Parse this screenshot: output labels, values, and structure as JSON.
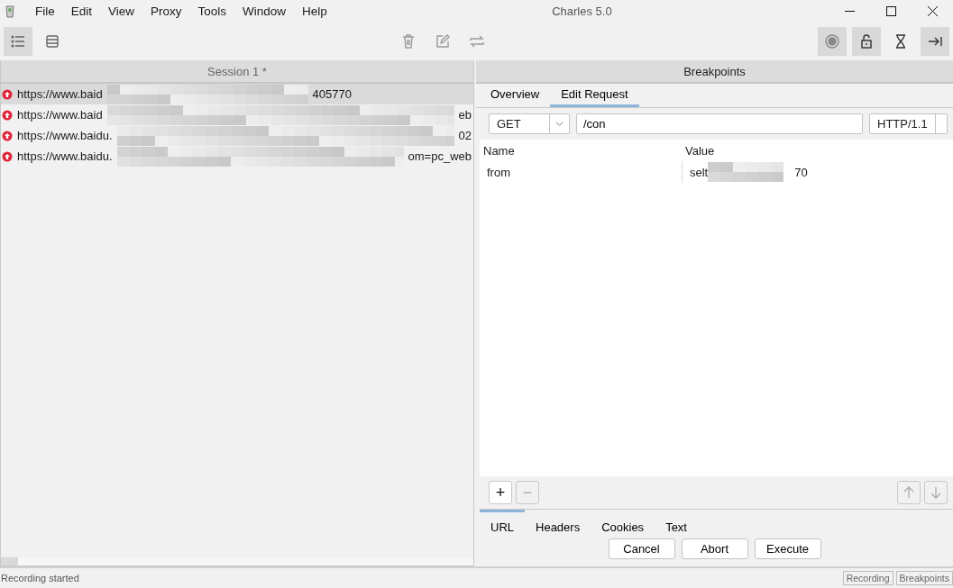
{
  "window": {
    "title": "Charles 5.0"
  },
  "menu": [
    "File",
    "Edit",
    "View",
    "Proxy",
    "Tools",
    "Window",
    "Help"
  ],
  "toolbar": {
    "left": [
      {
        "kind": "list",
        "active": true
      },
      {
        "kind": "rows",
        "active": false
      }
    ],
    "middle": [
      {
        "kind": "trash",
        "active": false
      },
      {
        "kind": "edit",
        "active": false
      },
      {
        "kind": "repeat",
        "active": false
      }
    ],
    "right": [
      {
        "kind": "record",
        "active": true
      },
      {
        "kind": "lock",
        "active": true
      },
      {
        "kind": "hourglass",
        "active": false
      },
      {
        "kind": "step",
        "active": true
      }
    ]
  },
  "session": {
    "title": "Session 1 *",
    "rows": [
      {
        "start": "https://www.baid",
        "end": "405770",
        "selected": true
      },
      {
        "start": "https://www.baid",
        "end": "eb",
        "selected": false
      },
      {
        "start": "https://www.baidu.",
        "end": "02",
        "selected": false
      },
      {
        "start": "https://www.baidu.",
        "end": "om=pc_web",
        "selected": false
      }
    ]
  },
  "breakpoints": {
    "title": "Breakpoints",
    "tabs": [
      {
        "label": "Overview",
        "selected": false
      },
      {
        "label": "Edit Request",
        "selected": true
      }
    ],
    "method": "GET",
    "path": "/con",
    "protocol": "HTTP/1.1",
    "columns": [
      "Name",
      "Value"
    ],
    "params": [
      {
        "name": "from",
        "value_start": "selt",
        "value_end": "70"
      }
    ],
    "row_buttons": [
      {
        "label": "+",
        "disabled": false
      },
      {
        "label": "−",
        "disabled": true
      }
    ],
    "move_buttons": [
      {
        "kind": "up",
        "disabled": true
      },
      {
        "kind": "down",
        "disabled": true
      }
    ],
    "bottom_tabs": [
      {
        "label": "URL",
        "selected": true
      },
      {
        "label": "Headers",
        "selected": false
      },
      {
        "label": "Cookies",
        "selected": false
      },
      {
        "label": "Text",
        "selected": false
      }
    ],
    "buttons": [
      "Cancel",
      "Abort",
      "Execute"
    ]
  },
  "status_bar": {
    "message": "Recording started",
    "indicators": [
      "Recording",
      "Breakpoints"
    ]
  }
}
